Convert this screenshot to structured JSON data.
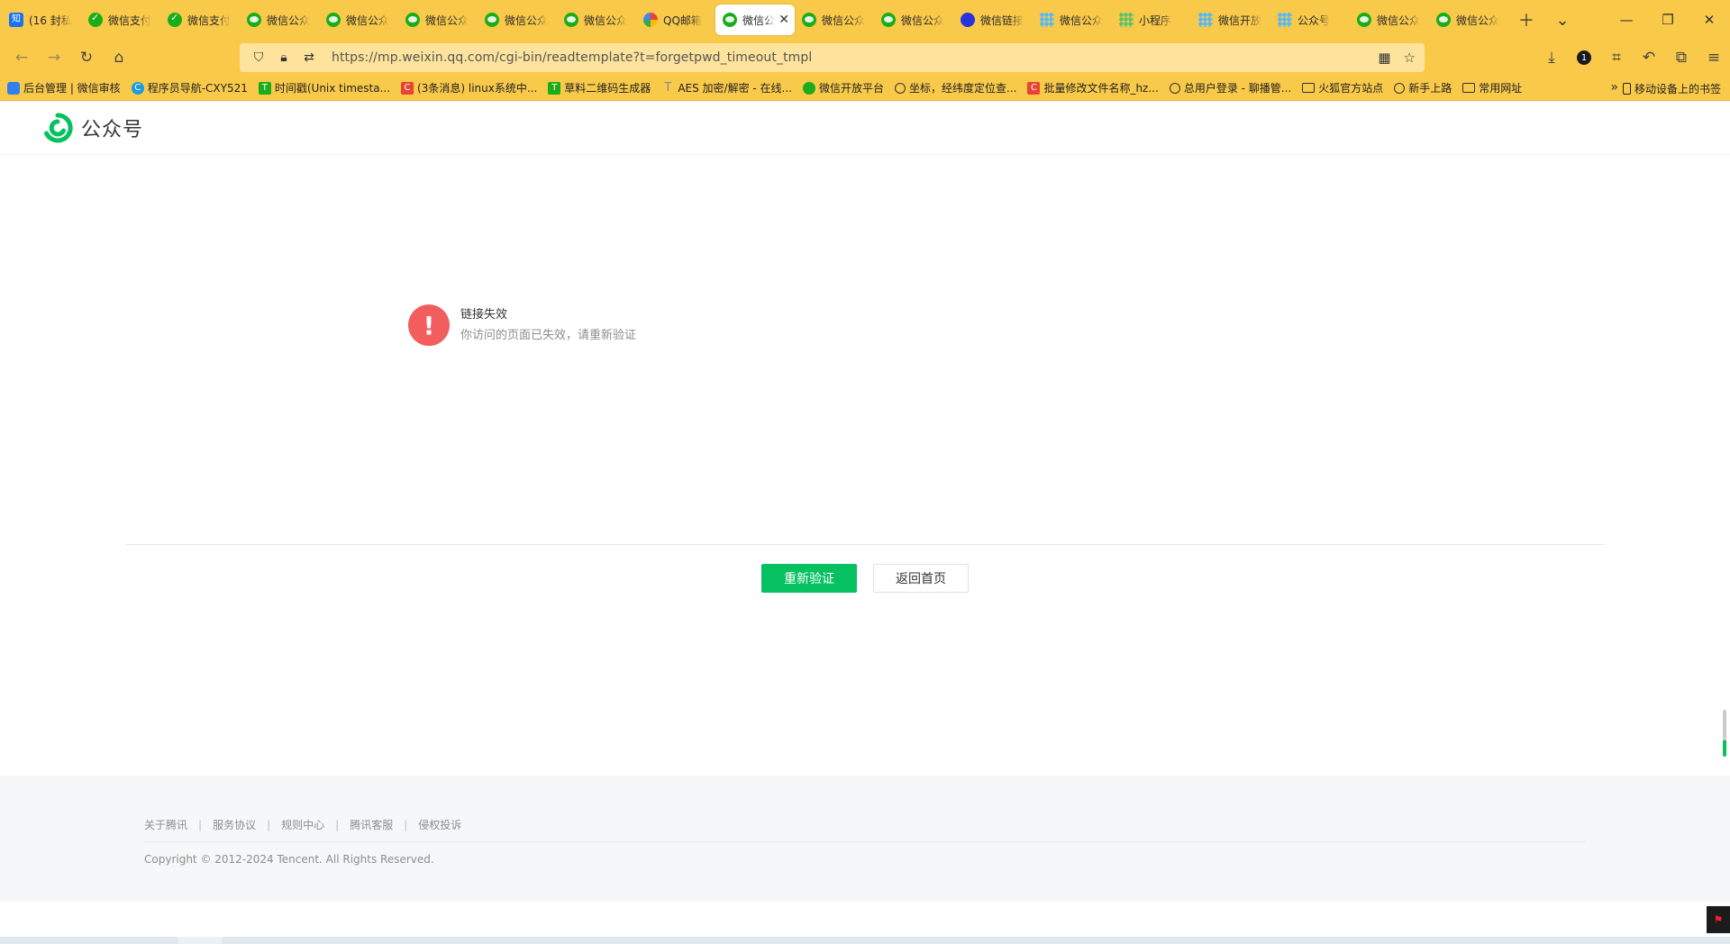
{
  "browser": {
    "tabs": [
      {
        "label": "(16 封私",
        "icon": "zhihu-icon"
      },
      {
        "label": "微信支付",
        "icon": "wechat-pay-icon"
      },
      {
        "label": "微信支付",
        "icon": "wechat-pay-icon"
      },
      {
        "label": "微信公众",
        "icon": "wechat-icon"
      },
      {
        "label": "微信公众",
        "icon": "wechat-icon"
      },
      {
        "label": "微信公众",
        "icon": "wechat-icon"
      },
      {
        "label": "微信公众",
        "icon": "wechat-icon"
      },
      {
        "label": "微信公众",
        "icon": "wechat-icon"
      },
      {
        "label": "QQ邮箱",
        "icon": "qq-mail-icon"
      },
      {
        "label": "微信公",
        "icon": "wechat-icon",
        "active": true
      },
      {
        "label": "微信公众",
        "icon": "wechat-icon"
      },
      {
        "label": "微信公众",
        "icon": "wechat-icon"
      },
      {
        "label": "微信链接",
        "icon": "baidu-icon"
      },
      {
        "label": "微信公众",
        "icon": "grid-icon"
      },
      {
        "label": "小程序",
        "icon": "grid-icon"
      },
      {
        "label": "微信开放",
        "icon": "grid-icon"
      },
      {
        "label": "公众号",
        "icon": "grid-icon"
      },
      {
        "label": "微信公众",
        "icon": "wechat-icon"
      },
      {
        "label": "微信公众",
        "icon": "wechat-icon"
      }
    ],
    "url": "https://mp.weixin.qq.com/cgi-bin/readtemplate?t=forgetpwd_timeout_tmpl",
    "extension_badge": "1",
    "bookmarks": [
      {
        "label": "后台管理 | 微信审核",
        "icon": "back"
      },
      {
        "label": "程序员导航-CXY521",
        "icon": "blue"
      },
      {
        "label": "时间戳(Unix timesta...",
        "icon": "green"
      },
      {
        "label": "(3条消息) linux系统中...",
        "icon": "red"
      },
      {
        "label": "草料二维码生成器",
        "icon": "green"
      },
      {
        "label": "AES 加密/解密 - 在线...",
        "icon": "aes"
      },
      {
        "label": "微信开放平台",
        "icon": "wx"
      },
      {
        "label": "坐标，经纬度定位查...",
        "icon": "globe"
      },
      {
        "label": "批量修改文件名称_hz...",
        "icon": "red"
      },
      {
        "label": "总用户登录 - 聊播管...",
        "icon": "globe"
      },
      {
        "label": "火狐官方站点",
        "icon": "folder"
      },
      {
        "label": "新手上路",
        "icon": "globe"
      },
      {
        "label": "常用网址",
        "icon": "folder"
      }
    ],
    "mobile_bookmarks": "移动设备上的书签"
  },
  "site": {
    "logo_text": "公众号",
    "error": {
      "icon_glyph": "!",
      "title": "链接失效",
      "description": "你访问的页面已失效，请重新验证"
    },
    "buttons": {
      "primary": "重新验证",
      "secondary": "返回首页"
    },
    "footer": {
      "links": [
        "关于腾讯",
        "服务协议",
        "规则中心",
        "腾讯客服",
        "侵权投诉"
      ],
      "copyright": "Copyright © 2012-2024 Tencent. All Rights Reserved."
    }
  },
  "colors": {
    "chrome": "#f9c94a",
    "primary_green": "#07c160",
    "error_red": "#f25e5e"
  }
}
